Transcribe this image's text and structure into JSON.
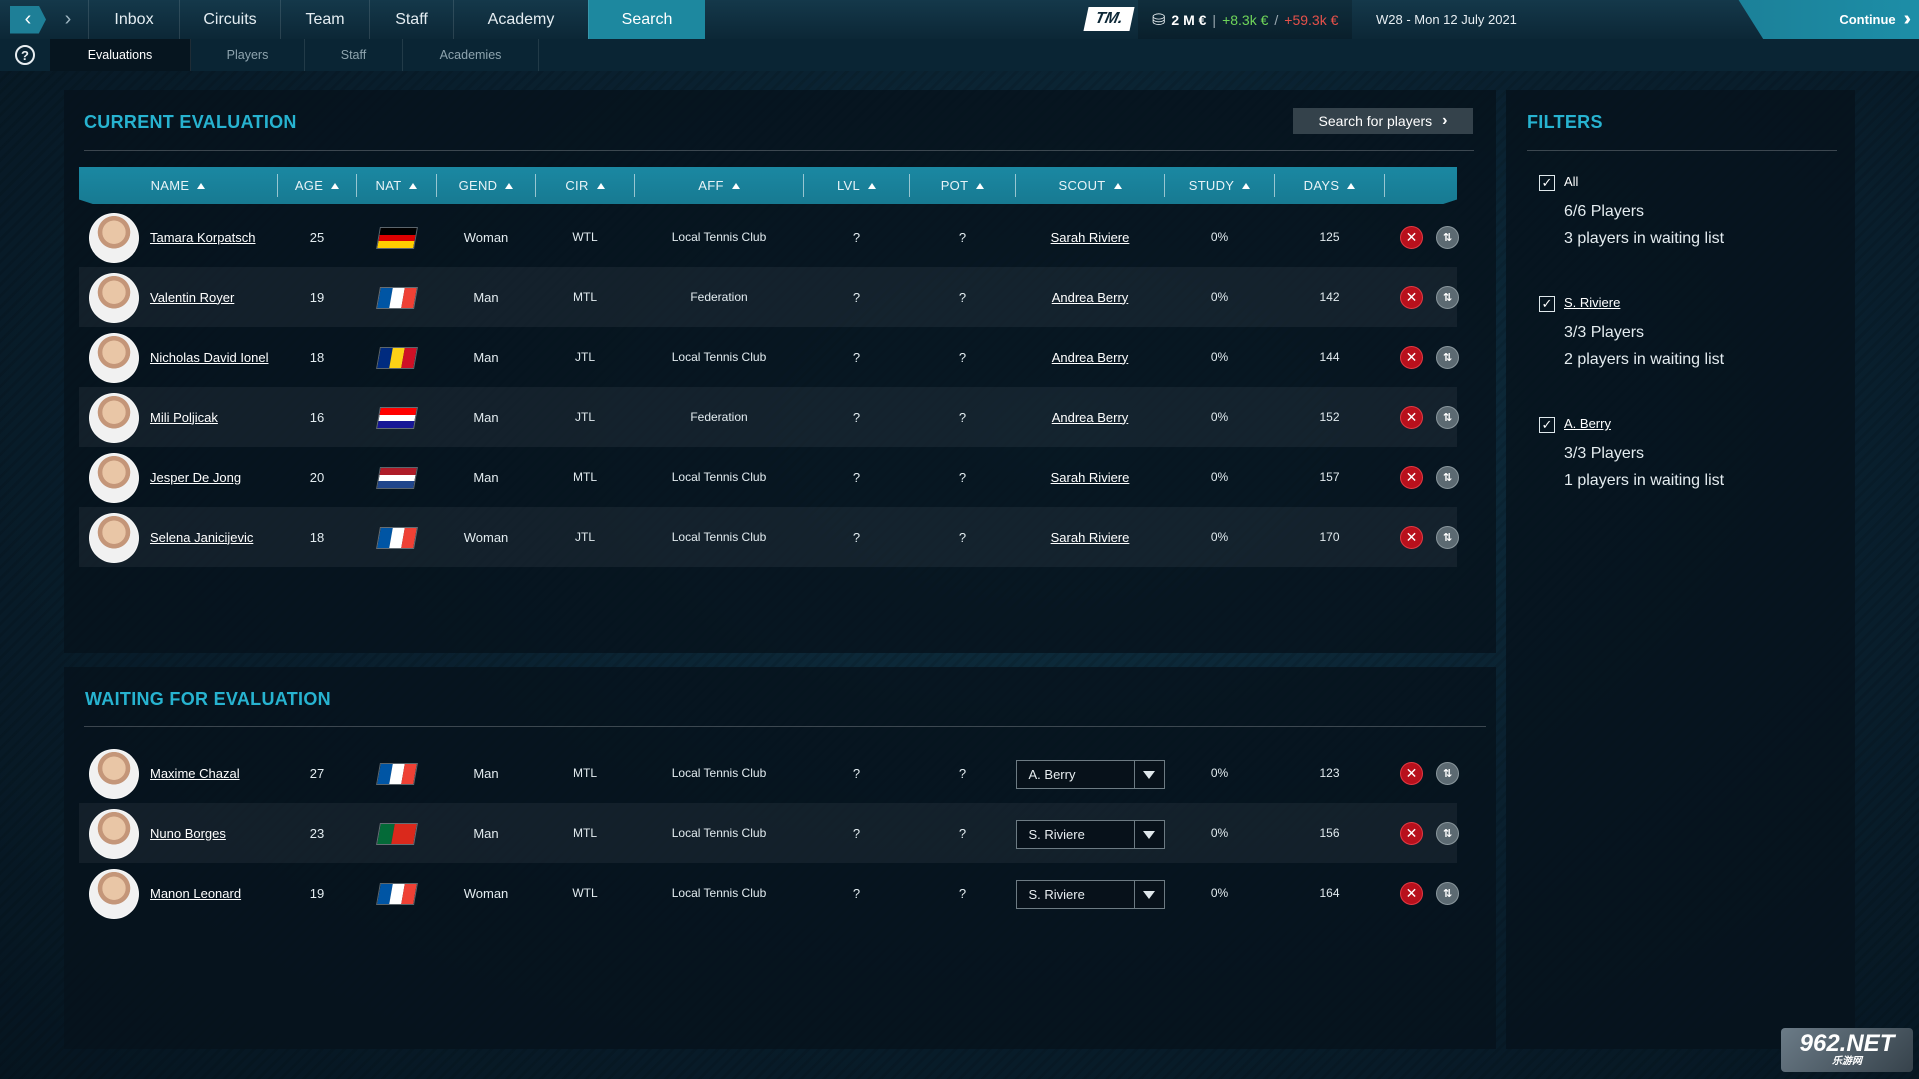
{
  "topbar": {
    "nav": [
      {
        "label": "Inbox",
        "active": false
      },
      {
        "label": "Circuits",
        "active": false
      },
      {
        "label": "Team",
        "active": false
      },
      {
        "label": "Staff",
        "active": false
      },
      {
        "label": "Academy",
        "active": false
      },
      {
        "label": "Search",
        "active": true
      }
    ],
    "brand": "TM.",
    "money": {
      "balance": "2 M €",
      "gain": "+8.3k €",
      "separator": "/",
      "loss": "+59.3k €"
    },
    "date": "W28 - Mon 12 July 2021",
    "continue_label": "Continue"
  },
  "subnav": {
    "help": "?",
    "tabs": [
      {
        "label": "Evaluations",
        "active": true
      },
      {
        "label": "Players",
        "active": false
      },
      {
        "label": "Staff",
        "active": false
      },
      {
        "label": "Academies",
        "active": false
      }
    ]
  },
  "current": {
    "title": "CURRENT EVALUATION",
    "search_button": "Search for players",
    "columns": [
      "NAME",
      "AGE",
      "NAT",
      "GEND",
      "CIR",
      "AFF",
      "LVL",
      "POT",
      "SCOUT",
      "STUDY",
      "DAYS"
    ],
    "rows": [
      {
        "name": "Tamara Korpatsch",
        "age": "25",
        "nat": "DE",
        "gend": "Woman",
        "cir": "WTL",
        "aff": "Local Tennis Club",
        "lvl": "?",
        "pot": "?",
        "scout": "Sarah Riviere",
        "study": "0%",
        "days": "125"
      },
      {
        "name": "Valentin Royer",
        "age": "19",
        "nat": "FR",
        "gend": "Man",
        "cir": "MTL",
        "aff": "Federation",
        "lvl": "?",
        "pot": "?",
        "scout": "Andrea Berry",
        "study": "0%",
        "days": "142"
      },
      {
        "name": "Nicholas David Ionel",
        "age": "18",
        "nat": "RO",
        "gend": "Man",
        "cir": "JTL",
        "aff": "Local Tennis Club",
        "lvl": "?",
        "pot": "?",
        "scout": "Andrea Berry",
        "study": "0%",
        "days": "144"
      },
      {
        "name": "Mili Poljicak",
        "age": "16",
        "nat": "HR",
        "gend": "Man",
        "cir": "JTL",
        "aff": "Federation",
        "lvl": "?",
        "pot": "?",
        "scout": "Andrea Berry",
        "study": "0%",
        "days": "152"
      },
      {
        "name": "Jesper De Jong",
        "age": "20",
        "nat": "NL",
        "gend": "Man",
        "cir": "MTL",
        "aff": "Local Tennis Club",
        "lvl": "?",
        "pot": "?",
        "scout": "Sarah Riviere",
        "study": "0%",
        "days": "157"
      },
      {
        "name": "Selena Janicijevic",
        "age": "18",
        "nat": "FR",
        "gend": "Woman",
        "cir": "JTL",
        "aff": "Local Tennis Club",
        "lvl": "?",
        "pot": "?",
        "scout": "Sarah Riviere",
        "study": "0%",
        "days": "170"
      }
    ]
  },
  "waiting": {
    "title": "WAITING FOR EVALUATION",
    "rows": [
      {
        "name": "Maxime Chazal",
        "age": "27",
        "nat": "FR",
        "gend": "Man",
        "cir": "MTL",
        "aff": "Local Tennis Club",
        "lvl": "?",
        "pot": "?",
        "scout": "A. Berry",
        "study": "0%",
        "days": "123"
      },
      {
        "name": "Nuno Borges",
        "age": "23",
        "nat": "PT",
        "gend": "Man",
        "cir": "MTL",
        "aff": "Local Tennis Club",
        "lvl": "?",
        "pot": "?",
        "scout": "S. Riviere",
        "study": "0%",
        "days": "156"
      },
      {
        "name": "Manon Leonard",
        "age": "19",
        "nat": "FR",
        "gend": "Woman",
        "cir": "WTL",
        "aff": "Local Tennis Club",
        "lvl": "?",
        "pot": "?",
        "scout": "S. Riviere",
        "study": "0%",
        "days": "164"
      }
    ]
  },
  "filters": {
    "title": "FILTERS",
    "groups": [
      {
        "label": "All",
        "checked": true,
        "players": "6/6 Players",
        "waiting": "3 players in waiting list"
      },
      {
        "label": "S. Riviere",
        "checked": true,
        "players": "3/3 Players",
        "waiting": "2 players in waiting list"
      },
      {
        "label": "A. Berry",
        "checked": true,
        "players": "3/3 Players",
        "waiting": "1 players in waiting list"
      }
    ]
  },
  "watermark": {
    "line1": "962.NET",
    "line2": "乐游网"
  },
  "colors": {
    "accent": "#1d889f",
    "title": "#27b3d0",
    "remove": "#b8101c",
    "gain": "#6fd55a",
    "loss": "#e5514a"
  }
}
